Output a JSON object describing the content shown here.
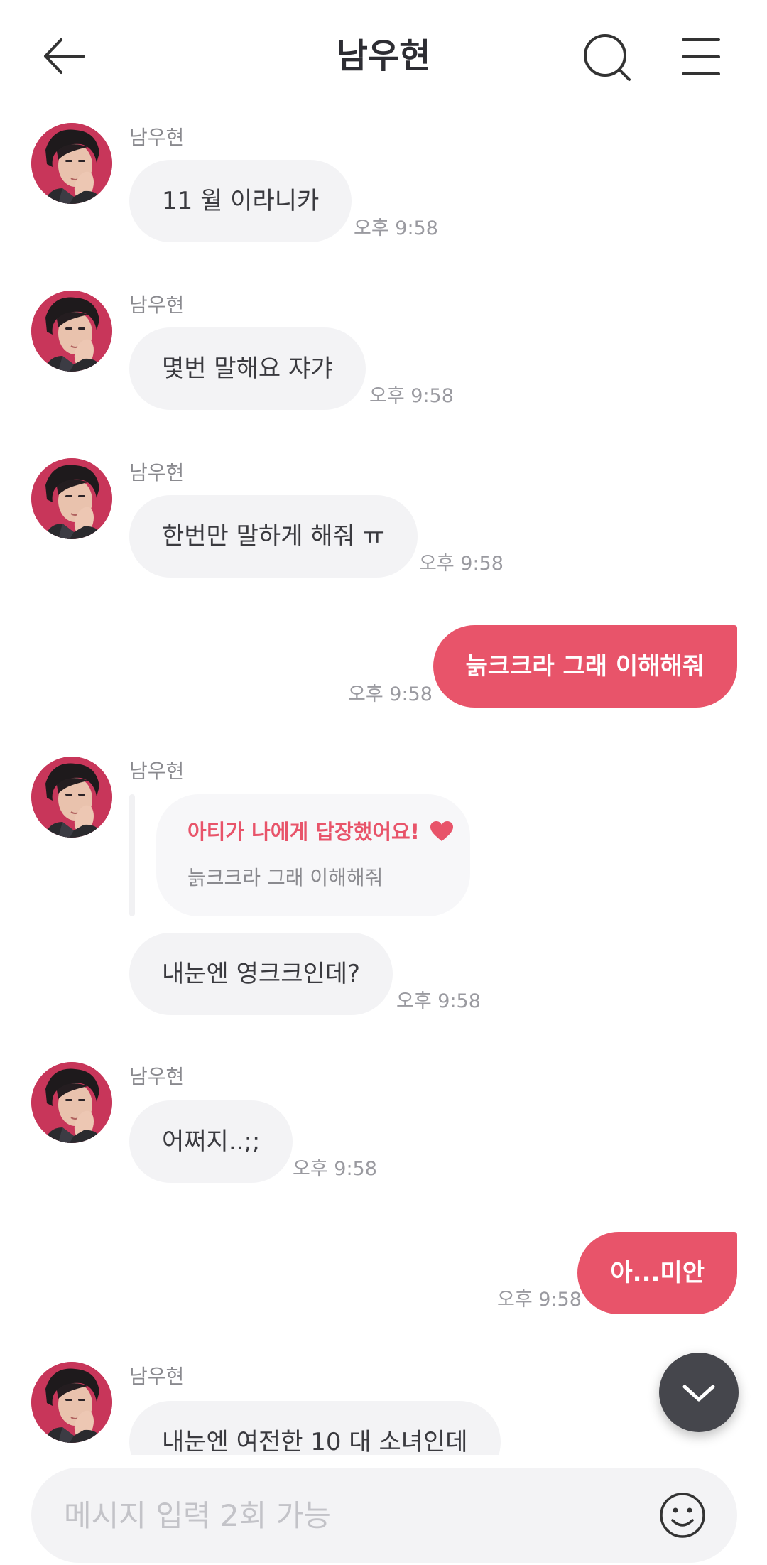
{
  "header": {
    "title": "남우현"
  },
  "sender_name": "남우현",
  "messages": [
    {
      "text": "11 월 이라니카",
      "time": "오후 9:58"
    },
    {
      "text": "몇번 말해요 쟈갸",
      "time": "오후 9:58"
    },
    {
      "text": "한번만 말하게 해줘 ㅠ",
      "time": "오후 9:58"
    },
    {
      "text": "늙크크라 그래 이해해줘",
      "time": "오후 9:58"
    },
    {
      "text": "내눈엔 영크크인데?",
      "time": "오후 9:58"
    },
    {
      "text": "어쩌지..;;",
      "time": "오후 9:58"
    },
    {
      "text": "아...미안",
      "time": "오후 9:58"
    },
    {
      "text": "내눈엔 여전한 10 대 소녀인데"
    }
  ],
  "reply": {
    "title": "아티가 나에게 답장했어요!",
    "quoted": "늙크크라 그래 이해해줘"
  },
  "input": {
    "placeholder": "메시지 입력 2회 가능"
  },
  "colors": {
    "accent": "#e8546a",
    "incoming_bubble": "#f3f3f5",
    "fab": "#45464c"
  },
  "icons": {
    "back": "arrow-left-icon",
    "search": "search-icon",
    "menu": "hamburger-menu-icon",
    "scroll_down": "chevron-down-icon",
    "emoji": "smiley-icon",
    "heart": "heart-icon"
  }
}
